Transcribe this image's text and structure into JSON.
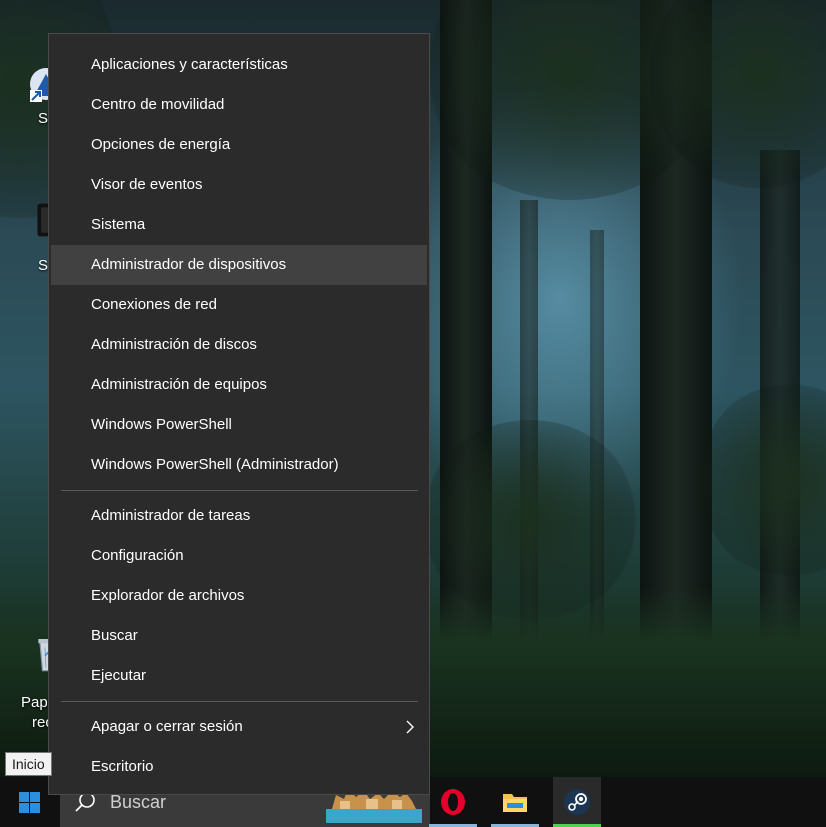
{
  "desktop": {
    "icons": [
      {
        "name": "desktop-icon-shortcut-1",
        "label": "S"
      },
      {
        "name": "desktop-icon-shortcut-2",
        "label": "S"
      },
      {
        "name": "desktop-icon-recycle-bin",
        "label_line1": "Pape",
        "label_line2": "rec"
      }
    ]
  },
  "context_menu": {
    "items": [
      {
        "label": "Aplicaciones y características"
      },
      {
        "label": "Centro de movilidad"
      },
      {
        "label": "Opciones de energía"
      },
      {
        "label": "Visor de eventos"
      },
      {
        "label": "Sistema"
      },
      {
        "label": "Administrador de dispositivos",
        "highlighted": true
      },
      {
        "label": "Conexiones de red"
      },
      {
        "label": "Administración de discos"
      },
      {
        "label": "Administración de equipos"
      },
      {
        "label": "Windows PowerShell"
      },
      {
        "label": "Windows PowerShell (Administrador)"
      }
    ],
    "items_group2": [
      {
        "label": "Administrador de tareas"
      },
      {
        "label": "Configuración"
      },
      {
        "label": "Explorador de archivos"
      },
      {
        "label": "Buscar"
      },
      {
        "label": "Ejecutar"
      }
    ],
    "items_group3": [
      {
        "label": "Apagar o cerrar sesión",
        "submenu": true
      },
      {
        "label": "Escritorio"
      }
    ]
  },
  "tooltip": {
    "text": "Inicio"
  },
  "taskbar": {
    "search_placeholder": "Buscar",
    "apps": [
      {
        "name": "opera-icon",
        "running": true
      },
      {
        "name": "file-explorer-icon",
        "running": true
      },
      {
        "name": "steam-icon",
        "running": true,
        "active": true
      }
    ]
  },
  "colors": {
    "menu_bg": "#2b2b2b",
    "menu_hover": "#414141",
    "taskbar_bg": "#101010",
    "search_bg": "#3a3a3a",
    "windows_blue": "#2b8fe0",
    "opera_red": "#e4002b",
    "active_underline": "#50d050"
  }
}
